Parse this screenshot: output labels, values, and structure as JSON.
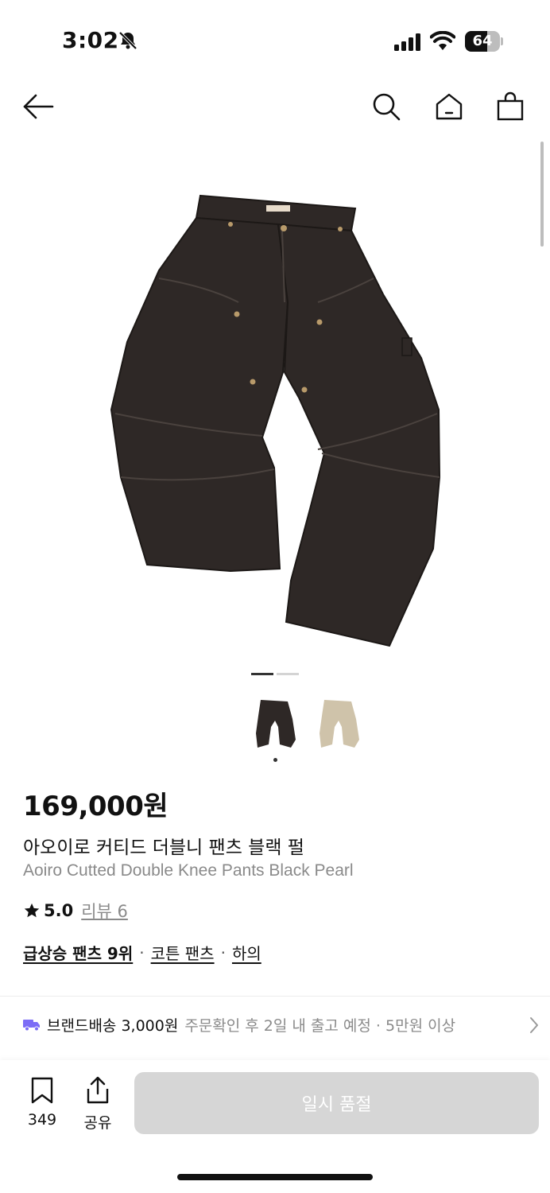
{
  "status": {
    "time": "3:02",
    "battery": "64",
    "battery_level": 0.64
  },
  "product": {
    "image_indicator": {
      "count": 2,
      "active": 1
    },
    "price": "169,000원",
    "name_ko": "아오이로 커티드 더블니 팬츠 블랙 펄",
    "name_en": "Aoiro Cutted Double Knee Pants Black Pearl",
    "rating": "5.0",
    "reviews_label": "리뷰 6",
    "categories": [
      {
        "label": "급상승 팬츠 9위"
      },
      {
        "label": "코튼 팬츠"
      },
      {
        "label": "하의"
      }
    ],
    "separator": "·"
  },
  "shipping": {
    "title": "브랜드배송 3,000원",
    "detail": "주문확인 후 2일 내 출고 예정 · 5만원 이상"
  },
  "bottom_bar": {
    "bookmark_count": "349",
    "share_label": "공유",
    "cta_label": "일시 품절"
  },
  "colors": {
    "accent_truck": "#7b6cf6",
    "pants_dark": "#2e2826",
    "pants_beige": "#cfc3aa",
    "cta_disabled": "#d6d6d6"
  },
  "icons": [
    "back-arrow-icon",
    "search-icon",
    "home-icon",
    "bag-icon",
    "truck-icon",
    "chevron-right-icon",
    "bookmark-icon",
    "share-icon"
  ]
}
